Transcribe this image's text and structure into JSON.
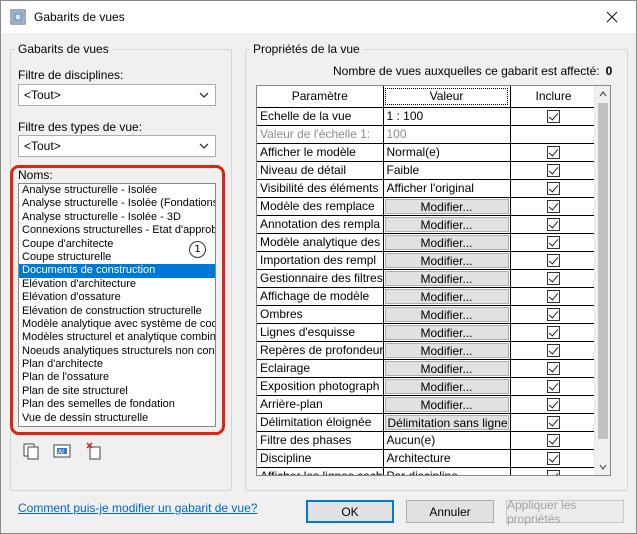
{
  "window": {
    "title": "Gabarits de vues",
    "close_icon": "close-icon"
  },
  "left_panel": {
    "group_title": "Gabarits de vues",
    "discipline_filter_label": "Filtre de disciplines:",
    "discipline_filter_value": "<Tout>",
    "view_type_filter_label": "Filtre des types de vue:",
    "view_type_filter_value": "<Tout>",
    "names_label": "Noms:",
    "names": [
      "Analyse structurelle - Isolée",
      "Analyse structurelle - Isolée (Fondations",
      "Analyse structurelle - Isolée - 3D",
      "Connexions structurelles - Etat d'approb",
      "Coupe d'architecte",
      "Coupe structurelle",
      "Documents de construction",
      "Elévation d'architecture",
      "Elévation d'ossature",
      "Elévation de construction structurelle",
      "Modèle analytique avec système de coo",
      "Modèles structurel et analytique combin",
      "Noeuds analytiques structurels non conr",
      "Plan d'architecte",
      "Plan de l'ossature",
      "Plan de site structurel",
      "Plan des semelles de fondation",
      "Vue de dessin structurelle"
    ],
    "selected_index": 6,
    "callout_number": "1",
    "highlight_color": "#e02410",
    "tool_icons": [
      "duplicate-icon",
      "rename-icon",
      "delete-icon"
    ]
  },
  "right_panel": {
    "group_title": "Propriétés de la vue",
    "count_label": "Nombre de vues auxquelles ce gabarit est affecté:",
    "count_value": "0",
    "columns": [
      "Paramètre",
      "Valeur",
      "Inclure"
    ],
    "rows": [
      {
        "param": "Echelle de la vue",
        "value": "1 : 100",
        "kind": "text",
        "include": true,
        "grey": false
      },
      {
        "param": "Valeur de l'échelle   1:",
        "value": "100",
        "kind": "text",
        "include": null,
        "grey": true
      },
      {
        "param": "Afficher le modèle",
        "value": "Normal(e)",
        "kind": "text",
        "include": true,
        "grey": false
      },
      {
        "param": "Niveau de détail",
        "value": "Faible",
        "kind": "text",
        "include": true,
        "grey": false
      },
      {
        "param": "Visibilité des éléments",
        "value": "Afficher l'original",
        "kind": "text",
        "include": true,
        "grey": false
      },
      {
        "param": "Modèle des remplace",
        "value": "Modifier...",
        "kind": "button",
        "include": true,
        "grey": false
      },
      {
        "param": "Annotation des rempla",
        "value": "Modifier...",
        "kind": "button",
        "include": true,
        "grey": false
      },
      {
        "param": "Modèle analytique des",
        "value": "Modifier...",
        "kind": "button",
        "include": true,
        "grey": false
      },
      {
        "param": "Importation des rempl",
        "value": "Modifier...",
        "kind": "button",
        "include": true,
        "grey": false
      },
      {
        "param": "Gestionnaire des filtres",
        "value": "Modifier...",
        "kind": "button",
        "include": true,
        "grey": false
      },
      {
        "param": "Affichage de modèle",
        "value": "Modifier...",
        "kind": "button",
        "include": true,
        "grey": false
      },
      {
        "param": "Ombres",
        "value": "Modifier...",
        "kind": "button",
        "include": true,
        "grey": false
      },
      {
        "param": "Lignes d'esquisse",
        "value": "Modifier...",
        "kind": "button",
        "include": true,
        "grey": false
      },
      {
        "param": "Repères de profondeur",
        "value": "Modifier...",
        "kind": "button",
        "include": true,
        "grey": false
      },
      {
        "param": "Eclairage",
        "value": "Modifier...",
        "kind": "button",
        "include": true,
        "grey": false
      },
      {
        "param": "Exposition photograph",
        "value": "Modifier...",
        "kind": "button",
        "include": true,
        "grey": false
      },
      {
        "param": "Arrière-plan",
        "value": "Modifier...",
        "kind": "button",
        "include": true,
        "grey": false
      },
      {
        "param": "Délimitation éloignée",
        "value": "Délimitation sans ligne",
        "kind": "button-wide",
        "include": true,
        "grey": false
      },
      {
        "param": "Filtre des phases",
        "value": "Aucun(e)",
        "kind": "text",
        "include": true,
        "grey": false
      },
      {
        "param": "Discipline",
        "value": "Architecture",
        "kind": "text",
        "include": true,
        "grey": false
      },
      {
        "param": "Afficher les lignes cach",
        "value": "Par discipline",
        "kind": "text",
        "include": true,
        "grey": false
      }
    ]
  },
  "footer": {
    "help_link": "Comment puis-je modifier un gabarit de vue?",
    "ok_label": "OK",
    "cancel_label": "Annuler",
    "apply_label": "Appliquer les propriétés"
  }
}
